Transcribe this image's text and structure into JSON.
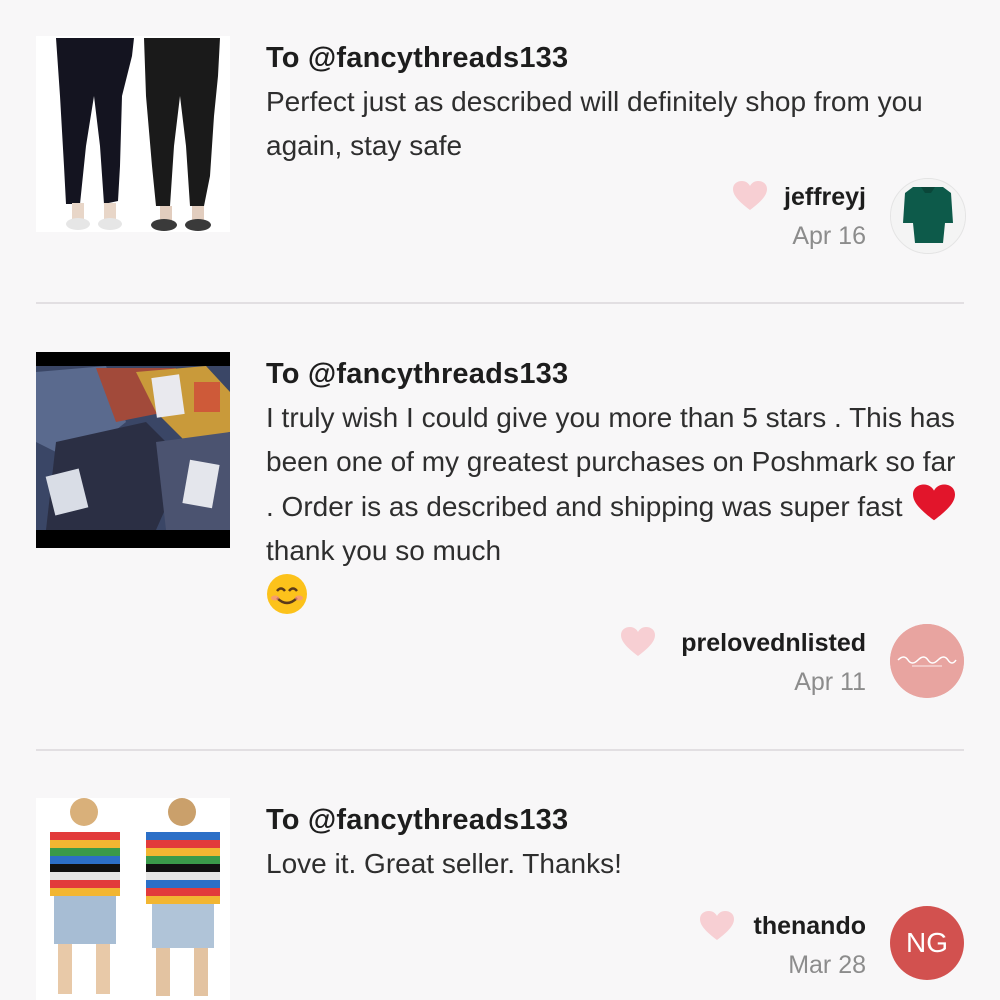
{
  "reviews": [
    {
      "to": "To @fancythreads133",
      "text": "Perfect just as described will definitely shop from you again, stay safe",
      "user": "jeffreyj",
      "date": "Apr 16",
      "avatar": {
        "type": "image",
        "icon": "green-sweater-icon"
      },
      "thumb_icon": "black-joggers-photo"
    },
    {
      "to": "To @fancythreads133",
      "text_part1": "I truly wish I could give you more than 5 stars . This has been one of my greatest purchases on Poshmark so far . Order is as described and shipping was super fast",
      "emoji1": "red-heart-emoji",
      "text_part2": "thank you so much",
      "emoji2": "smiling-face-emoji",
      "user": "prelovednlisted",
      "date": "Apr 11",
      "avatar": {
        "type": "logo",
        "color": "#e8a4a0"
      },
      "thumb_icon": "packaged-items-photo"
    },
    {
      "to": "To @fancythreads133",
      "text": "Love it. Great seller. Thanks!",
      "user": "thenando",
      "date": "Mar 28",
      "avatar": {
        "type": "initials",
        "initials": "NG",
        "color": "#d2514f"
      },
      "thumb_icon": "striped-tee-photo"
    }
  ],
  "colors": {
    "heart": "#f7cfd3",
    "divider": "#e2dfe2",
    "date": "#8c8c8c"
  }
}
